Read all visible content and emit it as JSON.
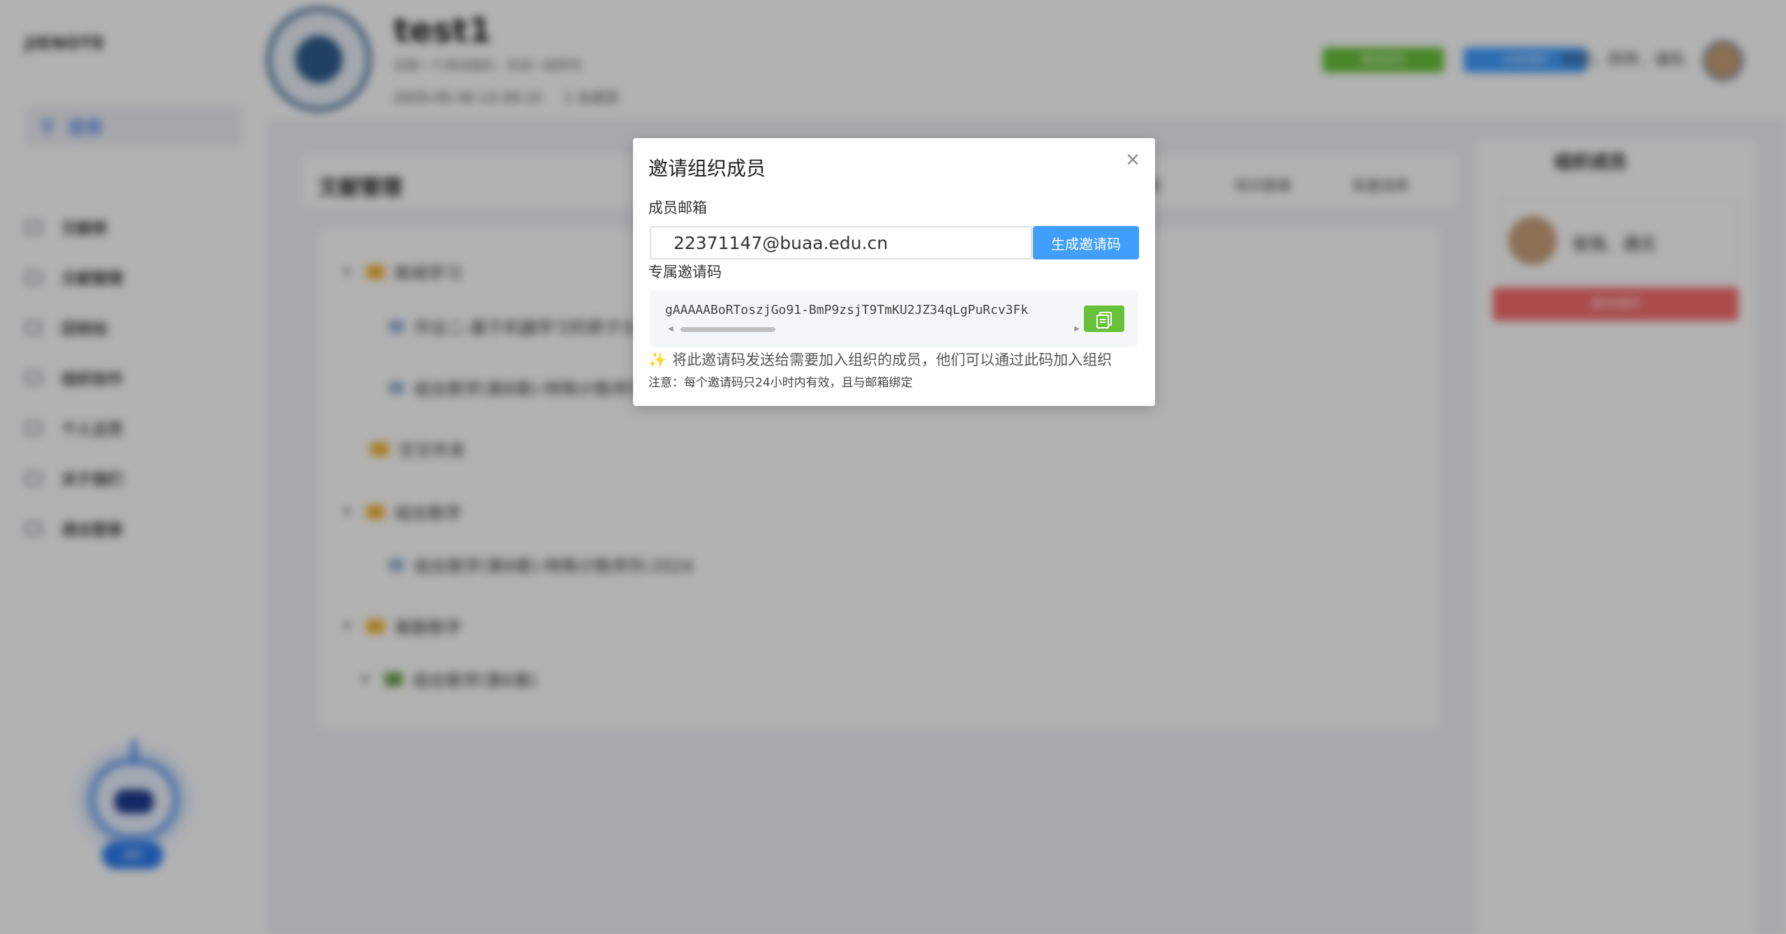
{
  "background": {
    "logo": "JIENOTE",
    "search_label": "搜索",
    "nav_items": [
      "文献库",
      "文献管理",
      "回收站",
      "组织协作",
      "个人主页",
      "关于我们",
      "退出登录"
    ],
    "robot_label": "JIN",
    "org": {
      "title": "test1",
      "description": "这是一个测试组织，欢迎一起研究",
      "created": "2025-05-30 13:39:15",
      "member_count": "1 位成员"
    },
    "top_buttons": {
      "invite": "邀请成员",
      "share": "分享组织"
    },
    "greeting": "你好，同学，请先",
    "section_title": "文献管理",
    "header_buttons": [
      "新建",
      "知识图谱",
      "批量选择"
    ],
    "tree": [
      "新闻学习",
      "作业二-基于机器学习的原子分析",
      "组合数学(第8章)-特殊计数序列",
      "空文件夹",
      "组合数学",
      "组合数学(第8章)-特殊计数序列-2024",
      "离散数学",
      "组合数学(第6章)"
    ],
    "members": {
      "title": "组织成员",
      "member_name": "俊我、遇见",
      "leave_button": "退出组织"
    }
  },
  "dialog": {
    "title": "邀请组织成员",
    "email_label": "成员邮箱",
    "email_value": "22371147@buaa.edu.cn",
    "generate_button": "生成邀请码",
    "code_label": "专属邀请码",
    "invite_code": "gAAAAABoRToszjGo91-BmP9zsjT9TmKU2JZ34qLgPuRcv3Fk",
    "hint": "将此邀请码发送给需要加入组织的成员，他们可以通过此码加入组织",
    "note": "注意：每个邀请码只24小时内有效，且与邮箱绑定"
  },
  "colors": {
    "primary": "#409eff",
    "success": "#67c23a",
    "danger": "#f56c6c",
    "mask": "rgba(0,0,0,0.3)"
  }
}
